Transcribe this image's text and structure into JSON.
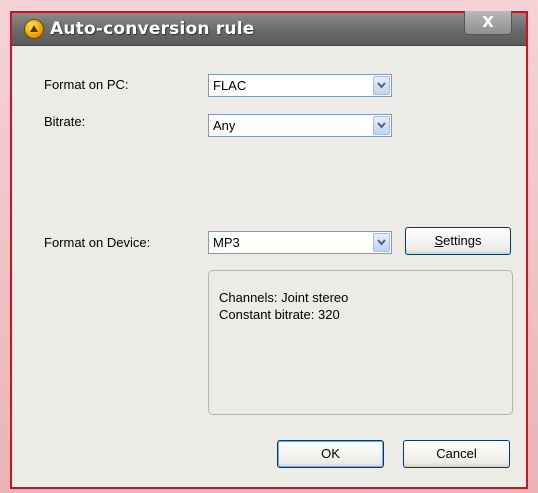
{
  "window": {
    "title": "Auto-conversion rule",
    "close_label": "X"
  },
  "form": {
    "format_pc_label": "Format on PC:",
    "format_pc_value": "FLAC",
    "bitrate_label": "Bitrate:",
    "bitrate_value": "Any",
    "format_device_label": "Format on Device:",
    "format_device_value": "MP3",
    "settings_accel": "S",
    "settings_rest": "ettings"
  },
  "info": {
    "channels": "Channels: Joint stereo",
    "bitrate": "Constant bitrate: 320"
  },
  "buttons": {
    "ok": "OK",
    "cancel": "Cancel"
  },
  "colors": {
    "frame_red": "#c81522",
    "titlebar": "#6a6a6a",
    "dialog_bg": "#ecebe6"
  },
  "icons": {
    "app": "app-icon",
    "dropdown": "chevron-down-icon",
    "close": "close-icon"
  }
}
